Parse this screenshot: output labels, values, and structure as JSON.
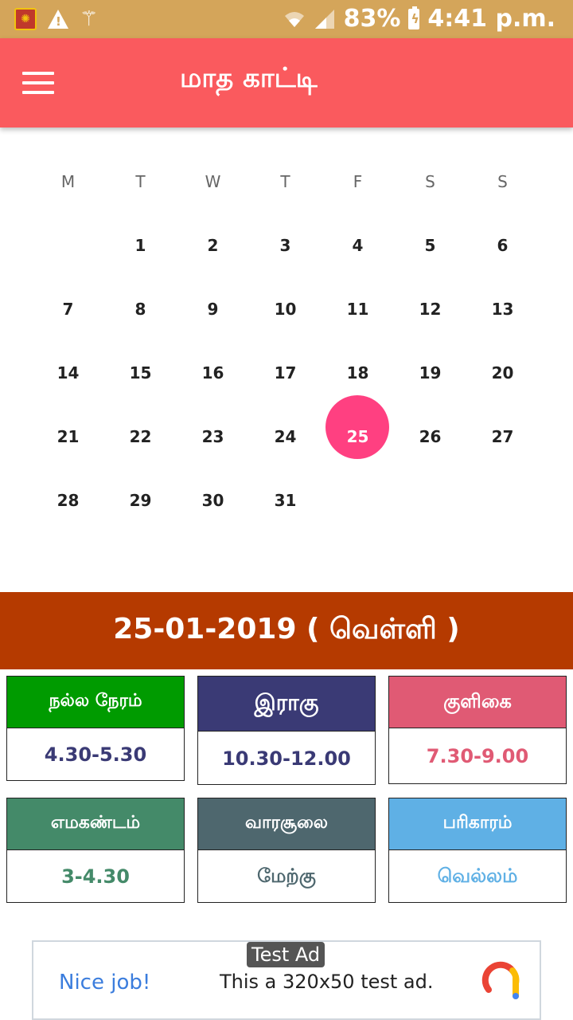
{
  "status_bar": {
    "battery": "83%",
    "time": "4:41 p.m."
  },
  "app_bar": {
    "title": "மாத காட்டி"
  },
  "calendar": {
    "weekdays": [
      "M",
      "T",
      "W",
      "T",
      "F",
      "S",
      "S"
    ],
    "weeks": [
      [
        "",
        "1",
        "2",
        "3",
        "4",
        "5",
        "6"
      ],
      [
        "7",
        "8",
        "9",
        "10",
        "11",
        "12",
        "13"
      ],
      [
        "14",
        "15",
        "16",
        "17",
        "18",
        "19",
        "20"
      ],
      [
        "21",
        "22",
        "23",
        "24",
        "25",
        "26",
        "27"
      ],
      [
        "28",
        "29",
        "30",
        "31",
        "",
        "",
        ""
      ]
    ],
    "selected_day": "25"
  },
  "date_banner": "25-01-2019 ( வெள்ளி )",
  "cards": [
    {
      "title": "நல்ல நேரம்",
      "value": "4.30-5.30",
      "head_color": "#009b00",
      "value_color": "#3a3a75"
    },
    {
      "title": "இராகு",
      "value": "10.30-12.00",
      "head_color": "#3a3a75",
      "value_color": "#3a3a75"
    },
    {
      "title": "குளிகை",
      "value": "7.30-9.00",
      "head_color": "#e05a74",
      "value_color": "#e05a74"
    },
    {
      "title": "எமகண்டம்",
      "value": "3-4.30",
      "head_color": "#448a69",
      "value_color": "#448a69"
    },
    {
      "title": "வாரசூலை",
      "value": "மேற்கு",
      "head_color": "#4e676e",
      "value_color": "#4e676e"
    },
    {
      "title": "பரிகாரம்",
      "value": "வெல்லம்",
      "head_color": "#5fb0e5",
      "value_color": "#5fb0e5"
    }
  ],
  "ad": {
    "tag": "Test Ad",
    "nice": "Nice job!",
    "text": "This a 320x50 test ad."
  }
}
